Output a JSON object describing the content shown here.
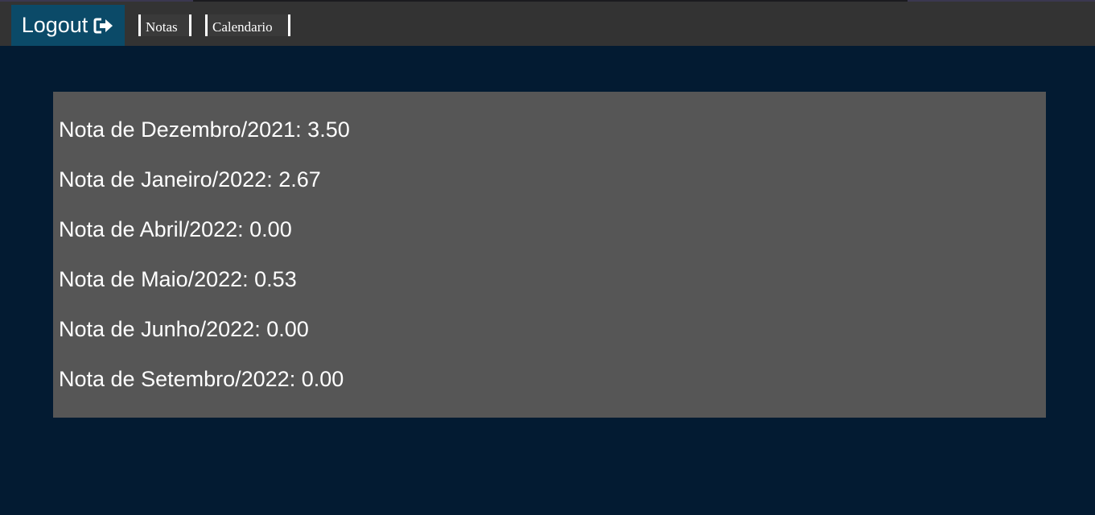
{
  "navbar": {
    "logout_label": "Logout",
    "logout_icon": "sign-out-icon",
    "links": [
      {
        "label": "Notas"
      },
      {
        "label": "Calendario"
      }
    ]
  },
  "grades": [
    {
      "text": "Nota de Dezembro/2021: 3.50"
    },
    {
      "text": "Nota de Janeiro/2022: 2.67"
    },
    {
      "text": "Nota de Abril/2022: 0.00"
    },
    {
      "text": "Nota de Maio/2022: 0.53"
    },
    {
      "text": "Nota de Junho/2022: 0.00"
    },
    {
      "text": "Nota de Setembro/2022: 0.00"
    }
  ],
  "colors": {
    "page_background": "#031b32",
    "navbar_background": "#333333",
    "logout_background": "#0b4a68",
    "panel_background": "#565656",
    "text": "#ffffff"
  }
}
